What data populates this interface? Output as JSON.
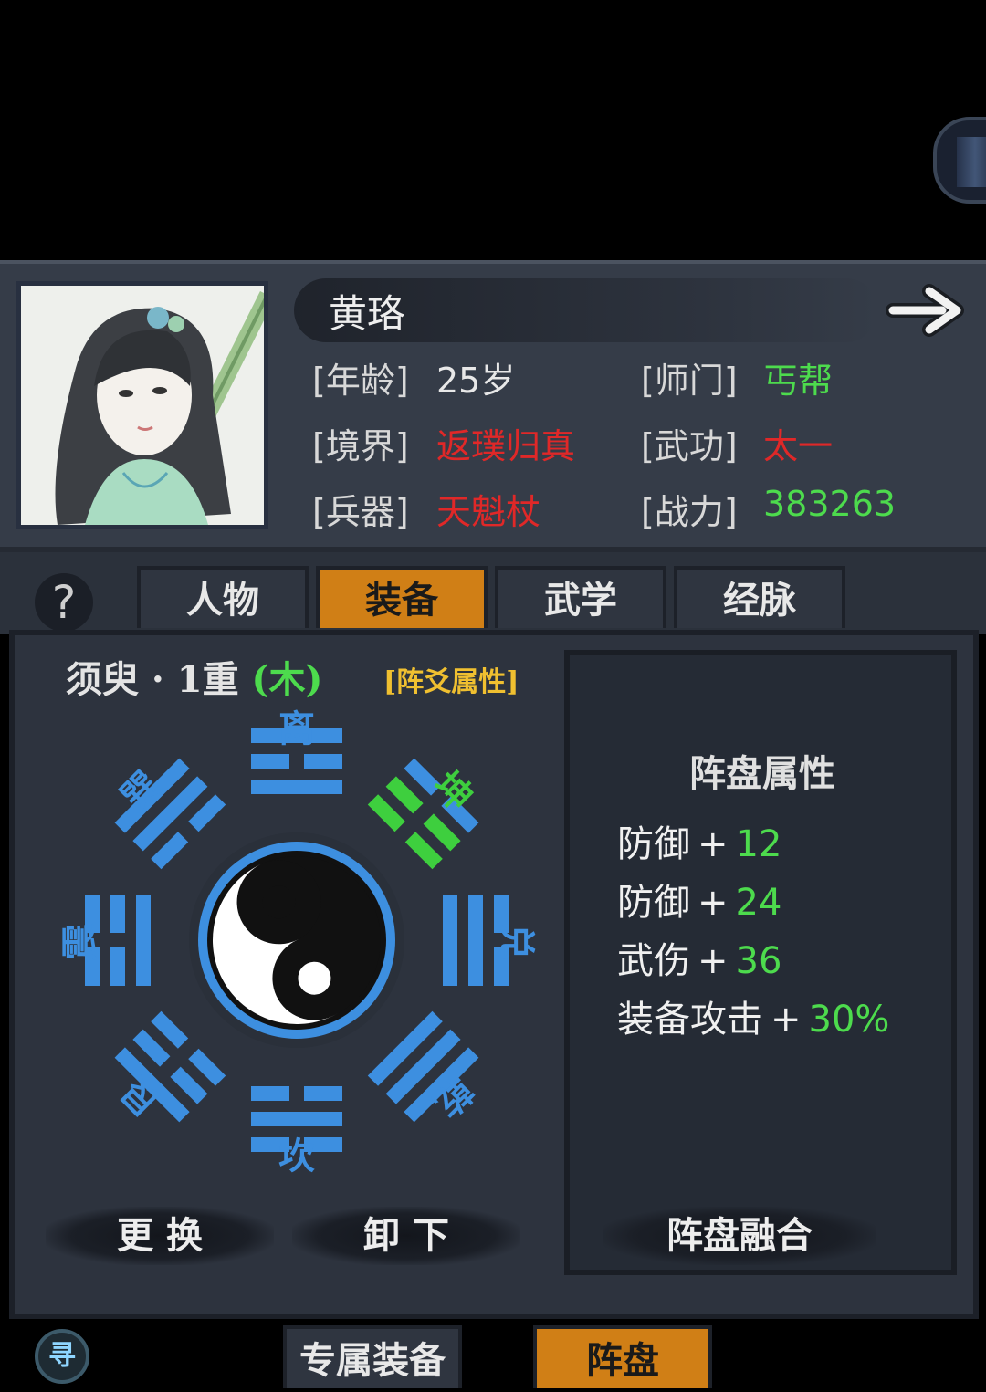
{
  "character": {
    "name": "黄珞",
    "age_label": "[年龄]",
    "age_value": "25岁",
    "sect_label": "[师门]",
    "sect_value": "丐帮",
    "realm_label": "[境界]",
    "realm_value": "返璞归真",
    "martial_label": "[武功]",
    "martial_value": "太一",
    "weapon_label": "[兵器]",
    "weapon_value": "天魁杖",
    "power_label": "[战力]",
    "power_value": "383263"
  },
  "tabs": [
    {
      "label": "人物",
      "active": false
    },
    {
      "label": "装备",
      "active": true
    },
    {
      "label": "武学",
      "active": false
    },
    {
      "label": "经脉",
      "active": false
    }
  ],
  "help_icon": "?",
  "formation": {
    "title_main": "须臾 · 1重",
    "title_element": "(木)",
    "attr_link": "[阵爻属性]",
    "trigrams": {
      "li": "离",
      "kun": "坤",
      "dui": "兑",
      "qian": "乾",
      "kan": "坎",
      "gen": "艮",
      "zhen": "震",
      "xun": "巽"
    }
  },
  "stats": {
    "title": "阵盘属性",
    "rows": [
      {
        "name": "防御",
        "op": "+",
        "value": "12"
      },
      {
        "name": "防御",
        "op": "+",
        "value": "24"
      },
      {
        "name": "武伤",
        "op": "+",
        "value": "36"
      },
      {
        "name": "装备攻击",
        "op": "+",
        "value": "30%"
      }
    ]
  },
  "buttons": {
    "replace": "更 换",
    "unload": "卸 下",
    "fuse": "阵盘融合"
  },
  "bottom_tabs": [
    {
      "label": "专属装备",
      "active": false
    },
    {
      "label": "阵盘",
      "active": true
    }
  ],
  "search_icon": "寻",
  "colors": {
    "accent_orange": "#d07f16",
    "trigram_blue": "#3d8fe0",
    "trigram_active_green": "#3ecf3e",
    "value_green": "#4ddb4d",
    "value_red": "#e02828",
    "link_yellow": "#f0c030"
  }
}
